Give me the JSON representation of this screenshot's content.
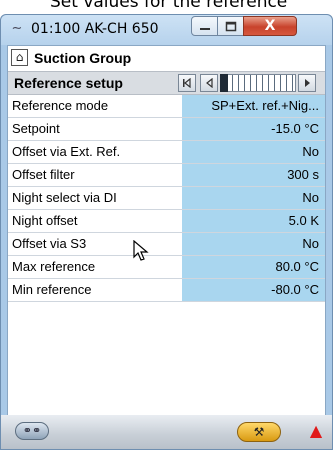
{
  "caption": "Set values for the reference",
  "window": {
    "title": "01:100 AK-CH 650",
    "app_icon": "plug-icon",
    "minimize_icon": "minimize-icon",
    "maximize_icon": "maximize-icon",
    "close_label": "X"
  },
  "group": {
    "title": "Suction Group",
    "home_icon": "home-icon"
  },
  "setup": {
    "title": "Reference setup",
    "nav_icons": [
      "first-page-icon",
      "previous-page-icon",
      "next-page-icon"
    ]
  },
  "rows": [
    {
      "label": "Reference mode",
      "value": "SP+Ext. ref.+Nig..."
    },
    {
      "label": "Setpoint",
      "value": "-15.0 °C"
    },
    {
      "label": "Offset via Ext. Ref.",
      "value": "No"
    },
    {
      "label": "Offset filter",
      "value": "300 s"
    },
    {
      "label": "Night select via DI",
      "value": "No"
    },
    {
      "label": "Night offset",
      "value": "5.0 K"
    },
    {
      "label": "Offset via S3",
      "value": "No"
    },
    {
      "label": "Max reference",
      "value": "80.0 °C"
    },
    {
      "label": "Min reference",
      "value": "-80.0 °C"
    }
  ],
  "bottom": {
    "left_icon": "glasses-icon",
    "service_icon": "wrench-icon",
    "alarm_icon": "alarm-bell-icon"
  },
  "colors": {
    "value_cell": "#a9d6ef",
    "window_frame": "#a9c9e7",
    "close_button": "#c8432c",
    "alarm": "#e01a1a",
    "service_button": "#e7b22a"
  }
}
